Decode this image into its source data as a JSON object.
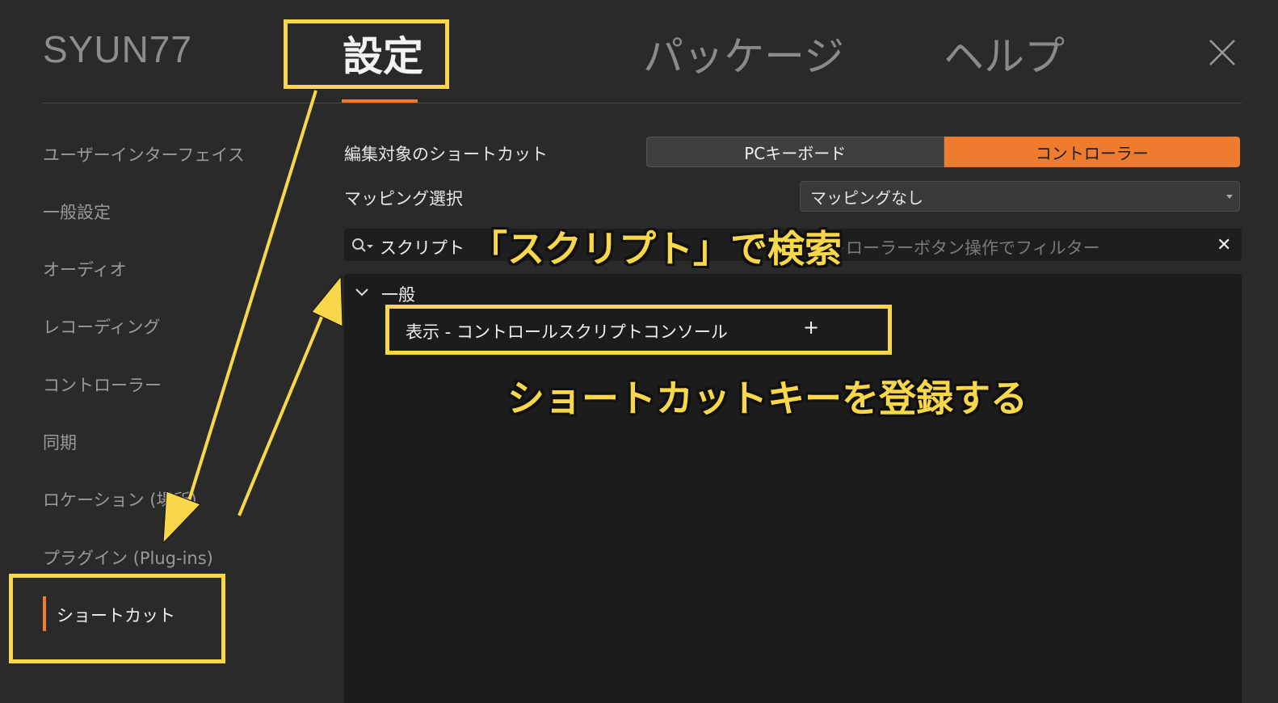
{
  "header": {
    "brand": "SYUN77",
    "tabs": [
      {
        "label": "設定",
        "active": true
      },
      {
        "label": "パッケージ",
        "active": false
      },
      {
        "label": "ヘルプ",
        "active": false
      }
    ]
  },
  "sidebar": {
    "items": [
      {
        "label": "ユーザーインターフェイス"
      },
      {
        "label": "一般設定"
      },
      {
        "label": "オーディオ"
      },
      {
        "label": "レコーディング"
      },
      {
        "label": "コントローラー"
      },
      {
        "label": "同期"
      },
      {
        "label": "ロケーション (場所)"
      },
      {
        "label": "プラグイン (Plug-ins)"
      },
      {
        "label": "ショートカット",
        "active": true
      }
    ]
  },
  "main": {
    "edit_target_label": "編集対象のショートカット",
    "edit_target_options": [
      "PCキーボード",
      "コントローラー"
    ],
    "edit_target_selected": "コントローラー",
    "mapping_label": "マッピング選択",
    "mapping_value": "マッピングなし",
    "search_value": "スクリプト",
    "search_placeholder": "トローラーボタン操作でフィルター",
    "group": {
      "label": "一般",
      "items": [
        {
          "label": "表示 - コントロールスクリプトコンソール",
          "action": "+"
        }
      ]
    }
  },
  "annotations": {
    "search_note": "「スクリプト」で検索",
    "register_note": "ショートカットキーを登録する"
  },
  "colors": {
    "accent": "#ef7b2e",
    "highlight": "#f8d84a",
    "background": "#2a2a2a"
  }
}
